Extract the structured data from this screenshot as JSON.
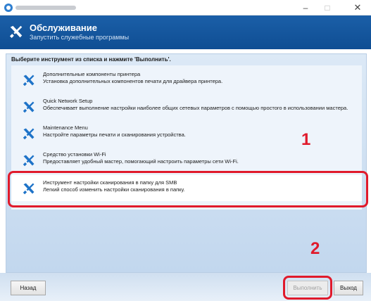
{
  "window": {
    "title": "",
    "minimize": "–",
    "maximize": "□",
    "close": "✕"
  },
  "header": {
    "title": "Обслуживание",
    "subtitle": "Запустить служебные программы",
    "icon": "tools-icon"
  },
  "instruction": "Выберите инструмент из списка и нажмите 'Выполнить'.",
  "tools": [
    {
      "title": "Дополнительные компоненты принтера",
      "description": "Установка дополнительных компонентов печати для драйвера принтера.",
      "icon": "tools-icon",
      "selected": false
    },
    {
      "title": "Quick Network Setup",
      "description": "Обеспечивает выполнение настройки наиболее общих сетевых параметров с помощью простого в использовании мастера.",
      "icon": "tools-icon",
      "selected": false
    },
    {
      "title": "Maintenance Menu",
      "description": "Настройте параметры печати и сканирования устройства.",
      "icon": "tools-icon",
      "selected": false
    },
    {
      "title": "Средство установки Wi-Fi",
      "description": "Предоставляет удобный мастер, помогающий настроить параметры сети Wi-Fi.",
      "icon": "tools-icon",
      "selected": false
    },
    {
      "title": "Инструмент настройки сканирования в папку для SMB",
      "description": "Легкий способ изменить настройки сканирования в папку.",
      "icon": "tools-icon",
      "selected": true
    }
  ],
  "callouts": [
    "1",
    "2"
  ],
  "footer": {
    "back": "Назад",
    "run": "Выполнить",
    "exit": "Выход"
  },
  "colors": {
    "header": "#1b5fa8",
    "callout": "#e01a2b",
    "icon": "#1e73c8"
  }
}
